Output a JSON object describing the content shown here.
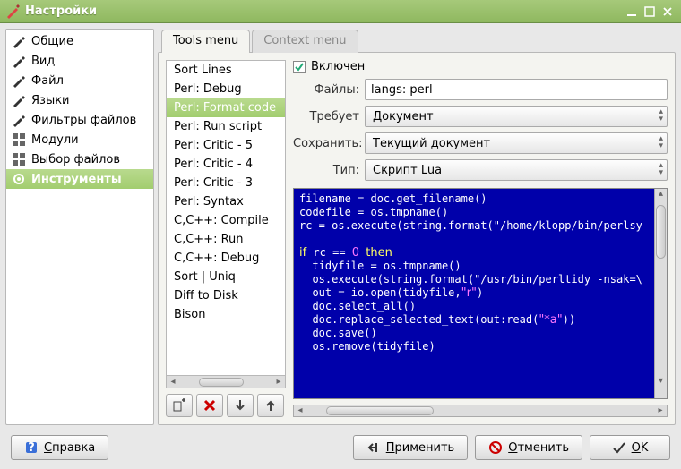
{
  "window": {
    "title": "Настройки"
  },
  "sidebar": {
    "items": [
      {
        "label": "Общие",
        "icon": "pencil"
      },
      {
        "label": "Вид",
        "icon": "pencil"
      },
      {
        "label": "Файл",
        "icon": "pencil"
      },
      {
        "label": "Языки",
        "icon": "pencil"
      },
      {
        "label": "Фильтры файлов",
        "icon": "pencil"
      },
      {
        "label": "Модули",
        "icon": "grid"
      },
      {
        "label": "Выбор файлов",
        "icon": "grid"
      },
      {
        "label": "Инструменты",
        "icon": "gear"
      }
    ],
    "selected_index": 7
  },
  "tabs": {
    "items": [
      "Tools menu",
      "Context menu"
    ],
    "active_index": 0
  },
  "tool_list": {
    "items": [
      "Sort Lines",
      "Perl: Debug",
      "Perl: Format code",
      "Perl: Run script",
      "Perl: Critic - 5",
      "Perl: Critic - 4",
      "Perl: Critic - 3",
      "Perl: Syntax",
      "C,C++: Compile",
      "C,C++: Run",
      "C,C++: Debug",
      "Sort | Uniq",
      "Diff to Disk",
      "Bison"
    ],
    "selected_index": 2
  },
  "form": {
    "enabled_label": "Включен",
    "enabled_checked": true,
    "files_label": "Файлы:",
    "files_value": "langs: perl",
    "requires_label": "Требует",
    "requires_value": "Документ",
    "save_label": "Сохранить:",
    "save_value": "Текущий документ",
    "type_label": "Тип:",
    "type_value": "Скрипт Lua"
  },
  "code": {
    "lines": [
      "filename = doc.get_filename()",
      "codefile = os.tmpname()",
      "rc = os.execute(string.format(\"/home/klopp/bin/perlsy",
      "",
      "if rc == 0 then",
      "  tidyfile = os.tmpname()",
      "  os.execute(string.format(\"/usr/bin/perltidy -nsak=\\",
      "  out = io.open(tidyfile,\"r\")",
      "  doc.select_all()",
      "  doc.replace_selected_text(out:read(\"*a\"))",
      "  doc.save()",
      "  os.remove(tidyfile)"
    ]
  },
  "buttons": {
    "help": "Справка",
    "apply": "Применить",
    "cancel": "Отменить",
    "ok": "OK"
  }
}
